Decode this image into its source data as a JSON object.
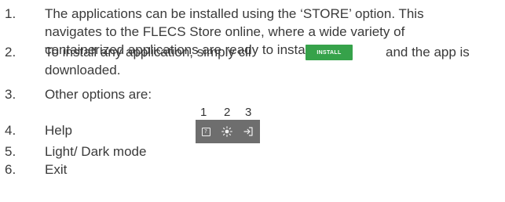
{
  "items": [
    {
      "num": "1.",
      "lines": [
        "The applications can be installed using the ‘STORE’ option. This",
        "navigates to the FLECS Store online, where a wide variety of",
        "containerized applications are ready to install."
      ]
    },
    {
      "num": "2.",
      "lines": [
        "To install any application, simply cli",
        "downloaded."
      ]
    },
    {
      "num": "3.",
      "lines": [
        "Other options are:"
      ]
    },
    {
      "num": "4.",
      "lines": [
        "Help"
      ]
    },
    {
      "num": "5.",
      "lines": [
        "Light/ Dark mode"
      ]
    },
    {
      "num": "6.",
      "lines": [
        "Exit"
      ]
    }
  ],
  "install_button": {
    "label": "INSTALL"
  },
  "item2_after_button": "and the app is",
  "options_toolbar": {
    "numbers": [
      "1",
      "2",
      "3"
    ],
    "icons": [
      "help-icon",
      "sun-icon",
      "exit-icon"
    ],
    "background_color": "#6e6e6e"
  },
  "colors": {
    "text": "#3a3a3a",
    "install_button": "#36a24a"
  }
}
